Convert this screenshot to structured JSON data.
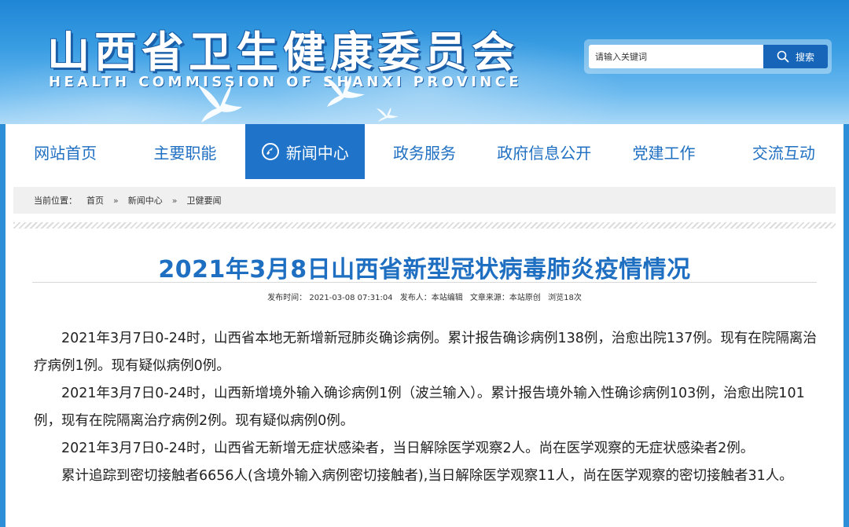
{
  "site": {
    "title": "山西省卫生健康委员会",
    "subtitle": "HEALTH COMMISSION OF SHANXI PROVINCE"
  },
  "search": {
    "placeholder": "请输入关键词",
    "button_label": "搜索"
  },
  "nav": {
    "items": [
      {
        "label": "网站首页"
      },
      {
        "label": "主要职能"
      },
      {
        "label": "新闻中心",
        "active": true
      },
      {
        "label": "政务服务"
      },
      {
        "label": "政府信息公开"
      },
      {
        "label": "党建工作"
      },
      {
        "label": "交流互动"
      }
    ]
  },
  "breadcrumb": {
    "prefix": "当前位置：",
    "items": [
      "首页",
      "新闻中心",
      "卫健要闻"
    ],
    "separator": "»"
  },
  "article": {
    "title": "2021年3月8日山西省新型冠状病毒肺炎疫情情况",
    "meta": {
      "publish_time": "发布时间： 2021-03-08 07:31:04",
      "publisher": "发布人：本站编辑",
      "source": "文章来源：本站原创",
      "views": "浏览18次"
    },
    "paragraphs": [
      "2021年3月7日0-24时，山西省本地无新增新冠肺炎确诊病例。累计报告确诊病例138例，治愈出院137例。现有在院隔离治疗病例1例。现有疑似病例0例。",
      "2021年3月7日0-24时，山西新增境外输入确诊病例1例（波兰输入）。累计报告境外输入性确诊病例103例，治愈出院101例，现有在院隔离治疗病例2例。现有疑似病例0例。",
      "2021年3月7日0-24时，山西省无新增无症状感染者，当日解除医学观察2人。尚在医学观察的无症状感染者2例。",
      "累计追踪到密切接触者6656人(含境外输入病例密切接触者),当日解除医学观察11人，尚在医学观察的密切接触者31人。"
    ]
  },
  "colors": {
    "brand_blue": "#1f73c9",
    "title_blue": "#1e6fc1",
    "search_button": "#1665b8"
  },
  "icons": {
    "search": "search-icon",
    "nav_active": "globe-icon"
  }
}
